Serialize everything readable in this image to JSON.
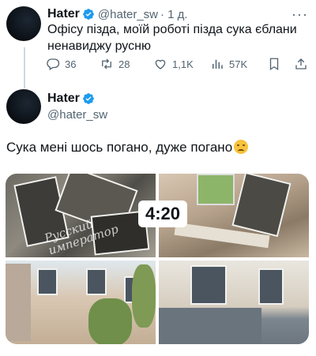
{
  "tweet1": {
    "name": "Hater",
    "handle": "@hater_sw",
    "time": "· 1 д.",
    "text": "Офісу пізда, моїй роботі пізда сука єблани ненавиджу русню",
    "more_icon": "more-icon",
    "stats": {
      "replies": "36",
      "retweets": "28",
      "likes": "1,1K",
      "views": "57K"
    }
  },
  "tweet2": {
    "name": "Hater",
    "handle": "@hater_sw",
    "text": "Сука мені шось погано, дуже погано",
    "media": {
      "video_time": "4:20",
      "watermark_line1": "Русский",
      "watermark_line2": "император"
    }
  },
  "colors": {
    "verified": "#1d9bf0",
    "muted": "#536471",
    "text": "#0f1419"
  }
}
